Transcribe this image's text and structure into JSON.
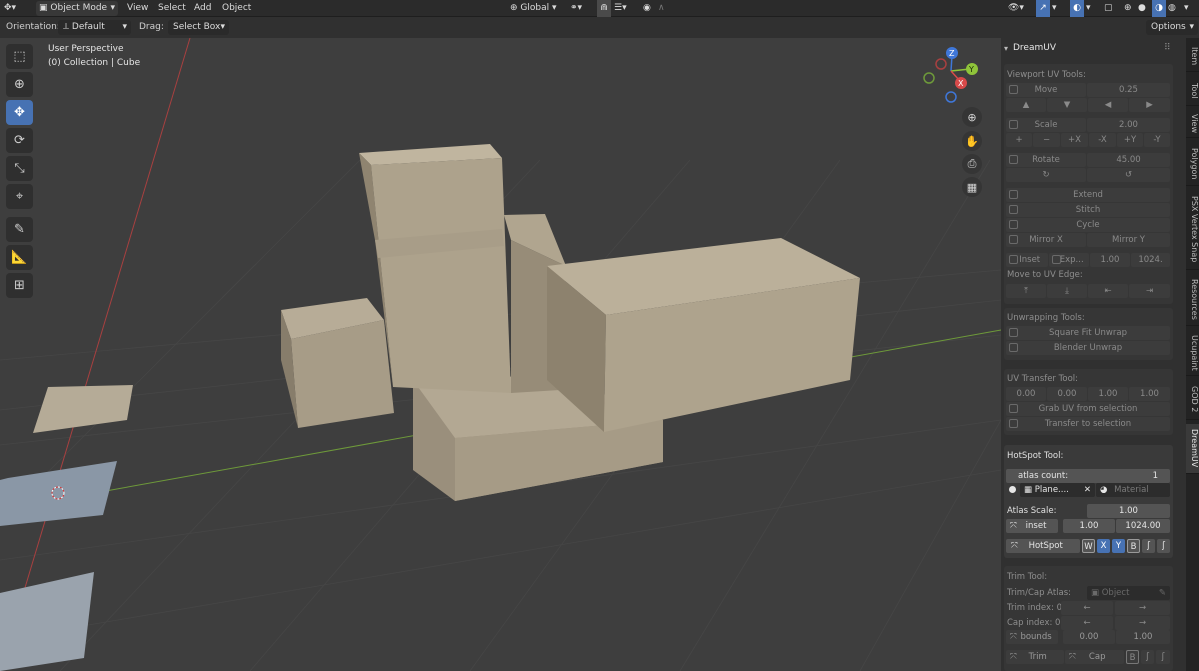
{
  "topbar": {
    "mode": "Object Mode",
    "menus": [
      "View",
      "Select",
      "Add",
      "Object"
    ],
    "transform_space": "Global"
  },
  "header": {
    "orientation_label": "Orientation:",
    "orientation_value": "Default",
    "drag_label": "Drag:",
    "drag_value": "Select Box",
    "options": "Options"
  },
  "viewport": {
    "view_name": "User Perspective",
    "collection": "(0) Collection | Cube",
    "gizmo": {
      "x": "X",
      "y": "Y",
      "z": "Z"
    }
  },
  "panel": {
    "title": "DreamUV",
    "viewport_uv_tools": {
      "heading": "Viewport UV Tools:",
      "move_label": "Move",
      "move_value": "0.25",
      "scale_label": "Scale",
      "scale_value": "2.00",
      "scale_buttons": [
        "+X",
        "-X",
        "+Y",
        "-Y"
      ],
      "rotate_label": "Rotate",
      "rotate_value": "45.00",
      "extend": "Extend",
      "stitch": "Stitch",
      "cycle": "Cycle",
      "mirror_x": "Mirror X",
      "mirror_y": "Mirror Y",
      "inset": "Inset",
      "expand": "Exp...",
      "inset_value": "1.00",
      "expand_value": "1024.",
      "move_to_edge": "Move to UV Edge:"
    },
    "unwrapping": {
      "heading": "Unwrapping Tools:",
      "square_fit": "Square Fit Unwrap",
      "blender_unwrap": "Blender Unwrap"
    },
    "uv_transfer": {
      "heading": "UV Transfer Tool:",
      "values": [
        "0.00",
        "0.00",
        "1.00",
        "1.00"
      ],
      "grab": "Grab UV from selection",
      "transfer": "Transfer to selection"
    },
    "hotspot": {
      "heading": "HotSpot Tool:",
      "atlas_count_label": "atlas count:",
      "atlas_count": "1",
      "plane_name": "Plane....",
      "material_placeholder": "Material",
      "atlas_scale_label": "Atlas Scale:",
      "atlas_scale": "1.00",
      "inset_label": "inset",
      "inset_a": "1.00",
      "inset_b": "1024.00",
      "hotspot_button": "HotSpot",
      "toggles": [
        "W",
        "X",
        "Y",
        "B"
      ]
    },
    "trim": {
      "heading": "Trim Tool:",
      "trimcap_label": "Trim/Cap Atlas:",
      "object_placeholder": "Object",
      "trim_index_label": "Trim index: 0",
      "cap_index_label": "Cap index: 0",
      "bounds_label": "bounds",
      "bounds_a": "0.00",
      "bounds_b": "1.00",
      "trim_button": "Trim",
      "cap_button": "Cap"
    }
  },
  "tabs": [
    "Item",
    "Tool",
    "View",
    "Polygon",
    "PSX Vertex Snap",
    "Resources",
    "Ucupaint",
    "GOD 2",
    "DreamUV"
  ],
  "colors": {
    "accent": "#4772b3",
    "x_axis": "#d84a4a",
    "y_axis": "#8fc43a",
    "z_axis": "#3f77d9",
    "grid_red": "#a84040",
    "grid_green": "#6e9a3a"
  }
}
